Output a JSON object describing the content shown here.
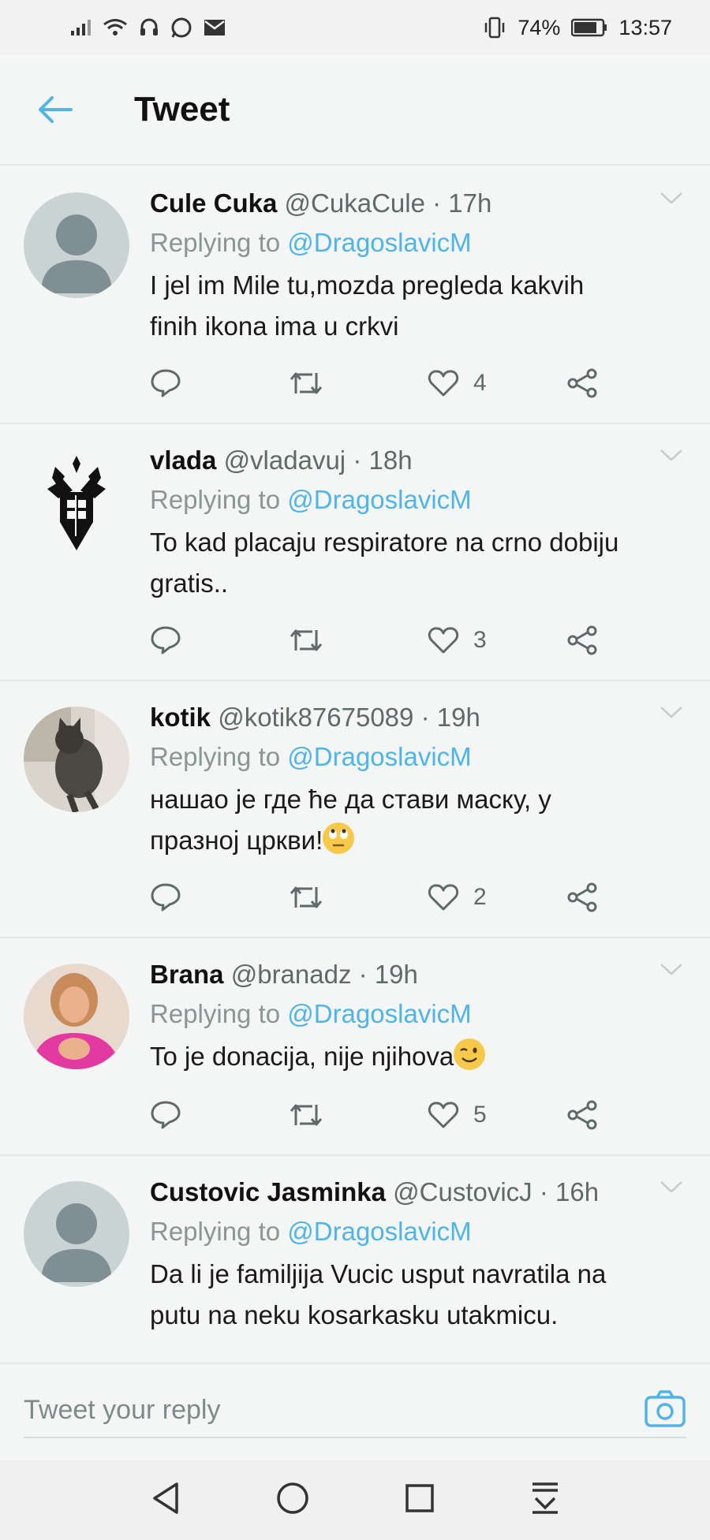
{
  "status_bar": {
    "battery": "74%",
    "time": "13:57"
  },
  "header": {
    "title": "Tweet"
  },
  "tweets": [
    {
      "name": "Cule Cuka",
      "handle": "@CukaCule",
      "time": "17h",
      "replying_label": "Replying to",
      "replying_to": "@DragoslavicM",
      "text_lines": [
        "I jel im Mile tu,mozda pregleda kakvih",
        "finih ikona ima u crkvi"
      ],
      "likes": "4",
      "avatar": "default-avatar"
    },
    {
      "name": "vlada",
      "handle": "@vladavuj",
      "time": "18h",
      "replying_label": "Replying to",
      "replying_to": "@DragoslavicM",
      "text_lines": [
        "To kad placaju respiratore na crno dobiju",
        "gratis.."
      ],
      "likes": "3",
      "avatar": "coat-of-arms-logo"
    },
    {
      "name": "kotik",
      "handle": "@kotik87675089",
      "time": "19h",
      "replying_label": "Replying to",
      "replying_to": "@DragoslavicM",
      "text_lines": [
        "нашао је где ће да стави маску, у",
        "празној цркви!"
      ],
      "emoji": "eye-roll-emoji",
      "likes": "2",
      "avatar": "cat-photo"
    },
    {
      "name": "Brana",
      "handle": "@branadz",
      "time": "19h",
      "replying_label": "Replying to",
      "replying_to": "@DragoslavicM",
      "text_lines": [
        "To je donacija, nije njihova"
      ],
      "emoji": "wink-emoji",
      "likes": "5",
      "avatar": "woman-photo"
    },
    {
      "name": "Custovic Jasminka",
      "handle": "@CustovicJ",
      "time": "16h",
      "replying_label": "Replying to",
      "replying_to": "@DragoslavicM",
      "text_lines": [
        "Da li je familjija Vucic usput navratila na",
        "putu na neku kosarkasku utakmicu."
      ],
      "avatar": "default-avatar"
    }
  ],
  "reply_bar": {
    "placeholder": "Tweet your reply"
  },
  "colors": {
    "accent": "#4fb4ea",
    "background": "#f4f6f5",
    "muted": "#8a9696"
  }
}
